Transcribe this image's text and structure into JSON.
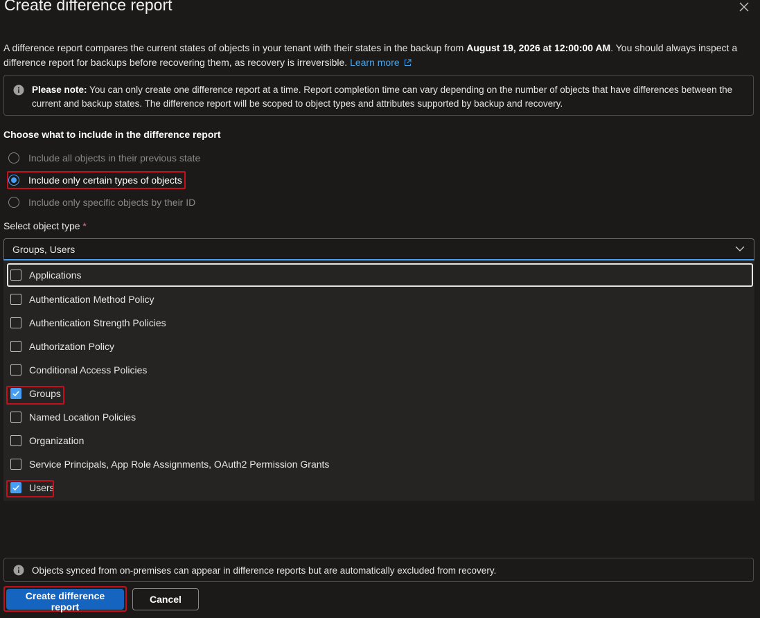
{
  "panel": {
    "title": "Create difference report",
    "intro_part1": "A difference report compares the current states of objects in your tenant with their states in the backup from ",
    "intro_date": "August 19, 2026 at 12:00:00 AM",
    "intro_part2": ". You should always inspect a difference report for backups before recovering them, as recovery is irreversible. ",
    "learn_more": "Learn more"
  },
  "note": {
    "bold": "Please note:",
    "text": " You can only create one difference report at a time. Report completion time can vary depending on the number of objects that have differences between the current and backup states. The difference report will be scoped to object types and attributes supported by backup and recovery."
  },
  "include_section": {
    "heading": "Choose what to include in the difference report",
    "options": [
      {
        "label": "Include all objects in their previous state",
        "selected": false
      },
      {
        "label": "Include only certain types of objects",
        "selected": true
      },
      {
        "label": "Include only specific objects by their ID",
        "selected": false
      }
    ]
  },
  "object_type": {
    "label": "Select object type",
    "required_mark": "*",
    "value": "Groups, Users",
    "options": [
      {
        "label": "Applications",
        "checked": false
      },
      {
        "label": "Authentication Method Policy",
        "checked": false
      },
      {
        "label": "Authentication Strength Policies",
        "checked": false
      },
      {
        "label": "Authorization Policy",
        "checked": false
      },
      {
        "label": "Conditional Access Policies",
        "checked": false
      },
      {
        "label": "Groups",
        "checked": true
      },
      {
        "label": "Named Location Policies",
        "checked": false
      },
      {
        "label": "Organization",
        "checked": false
      },
      {
        "label": "Service Principals, App Role Assignments, OAuth2 Permission Grants",
        "checked": false
      },
      {
        "label": "Users",
        "checked": true
      }
    ]
  },
  "footer_note": "Objects synced from on-premises can appear in difference reports but are automatically excluded from recovery.",
  "buttons": {
    "create": "Create difference report",
    "cancel": "Cancel"
  },
  "colors": {
    "background": "#1b1a19",
    "accent": "#479ef5",
    "primary_button": "#1565c0",
    "highlight": "#c50f1f"
  }
}
